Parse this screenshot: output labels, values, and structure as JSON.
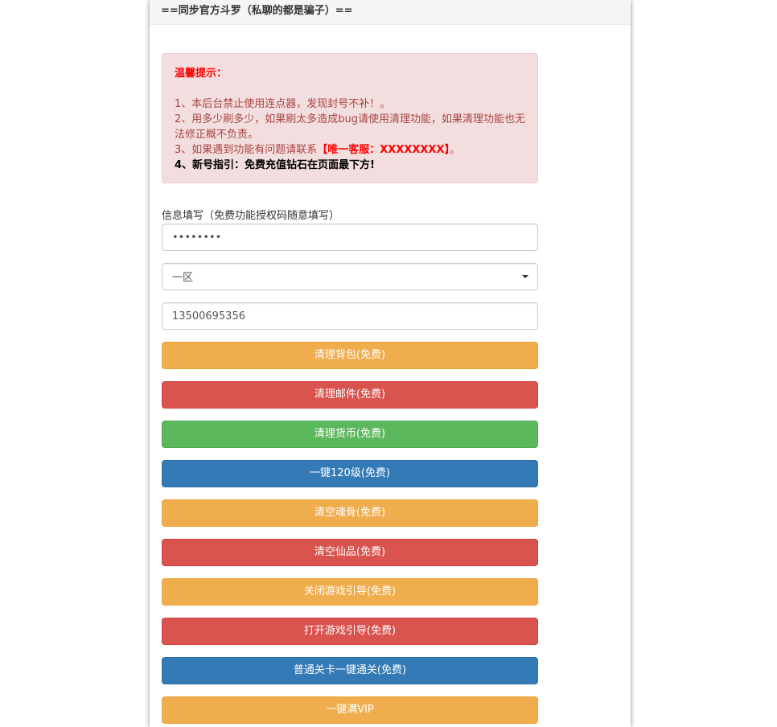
{
  "header": {
    "title": "==同步官方斗罗（私聊的都是骗子）=="
  },
  "notice": {
    "title": "温馨提示：",
    "line1": "1、本后台禁止使用连点器，发现封号不补！。",
    "line2": "2、用多少刷多少，如果刷太多造成bug请使用清理功能，如果清理功能也无法修正概不负责。",
    "line3_prefix": "3、如果遇到功能有问题请联系",
    "line3_highlight": "【唯一客服：XXXXXXXX】",
    "line3_suffix": "。",
    "line4": "4、新号指引：免费充值钻石在页面最下方!"
  },
  "form": {
    "label": "信息填写（免费功能授权码随意填写）",
    "password_value": "••••••••",
    "server_selected": "一区",
    "account_value": "13500695356"
  },
  "colors": {
    "warning": "#f0ad4e",
    "danger": "#d9534f",
    "success": "#5cb85c",
    "primary": "#337ab7"
  },
  "buttons": [
    {
      "label": "清理背包(免费)",
      "style": "warning"
    },
    {
      "label": "清理邮件(免费)",
      "style": "danger"
    },
    {
      "label": "清理货币(免费)",
      "style": "success"
    },
    {
      "label": "一键120级(免费)",
      "style": "primary"
    },
    {
      "label": "清空魂骨(免费)",
      "style": "warning"
    },
    {
      "label": "清空仙品(免费)",
      "style": "danger"
    },
    {
      "label": "关闭游戏引导(免费)",
      "style": "warning"
    },
    {
      "label": "打开游戏引导(免费)",
      "style": "danger"
    },
    {
      "label": "普通关卡一键通关(免费)",
      "style": "primary"
    },
    {
      "label": "一键满VIP",
      "style": "warning"
    }
  ]
}
